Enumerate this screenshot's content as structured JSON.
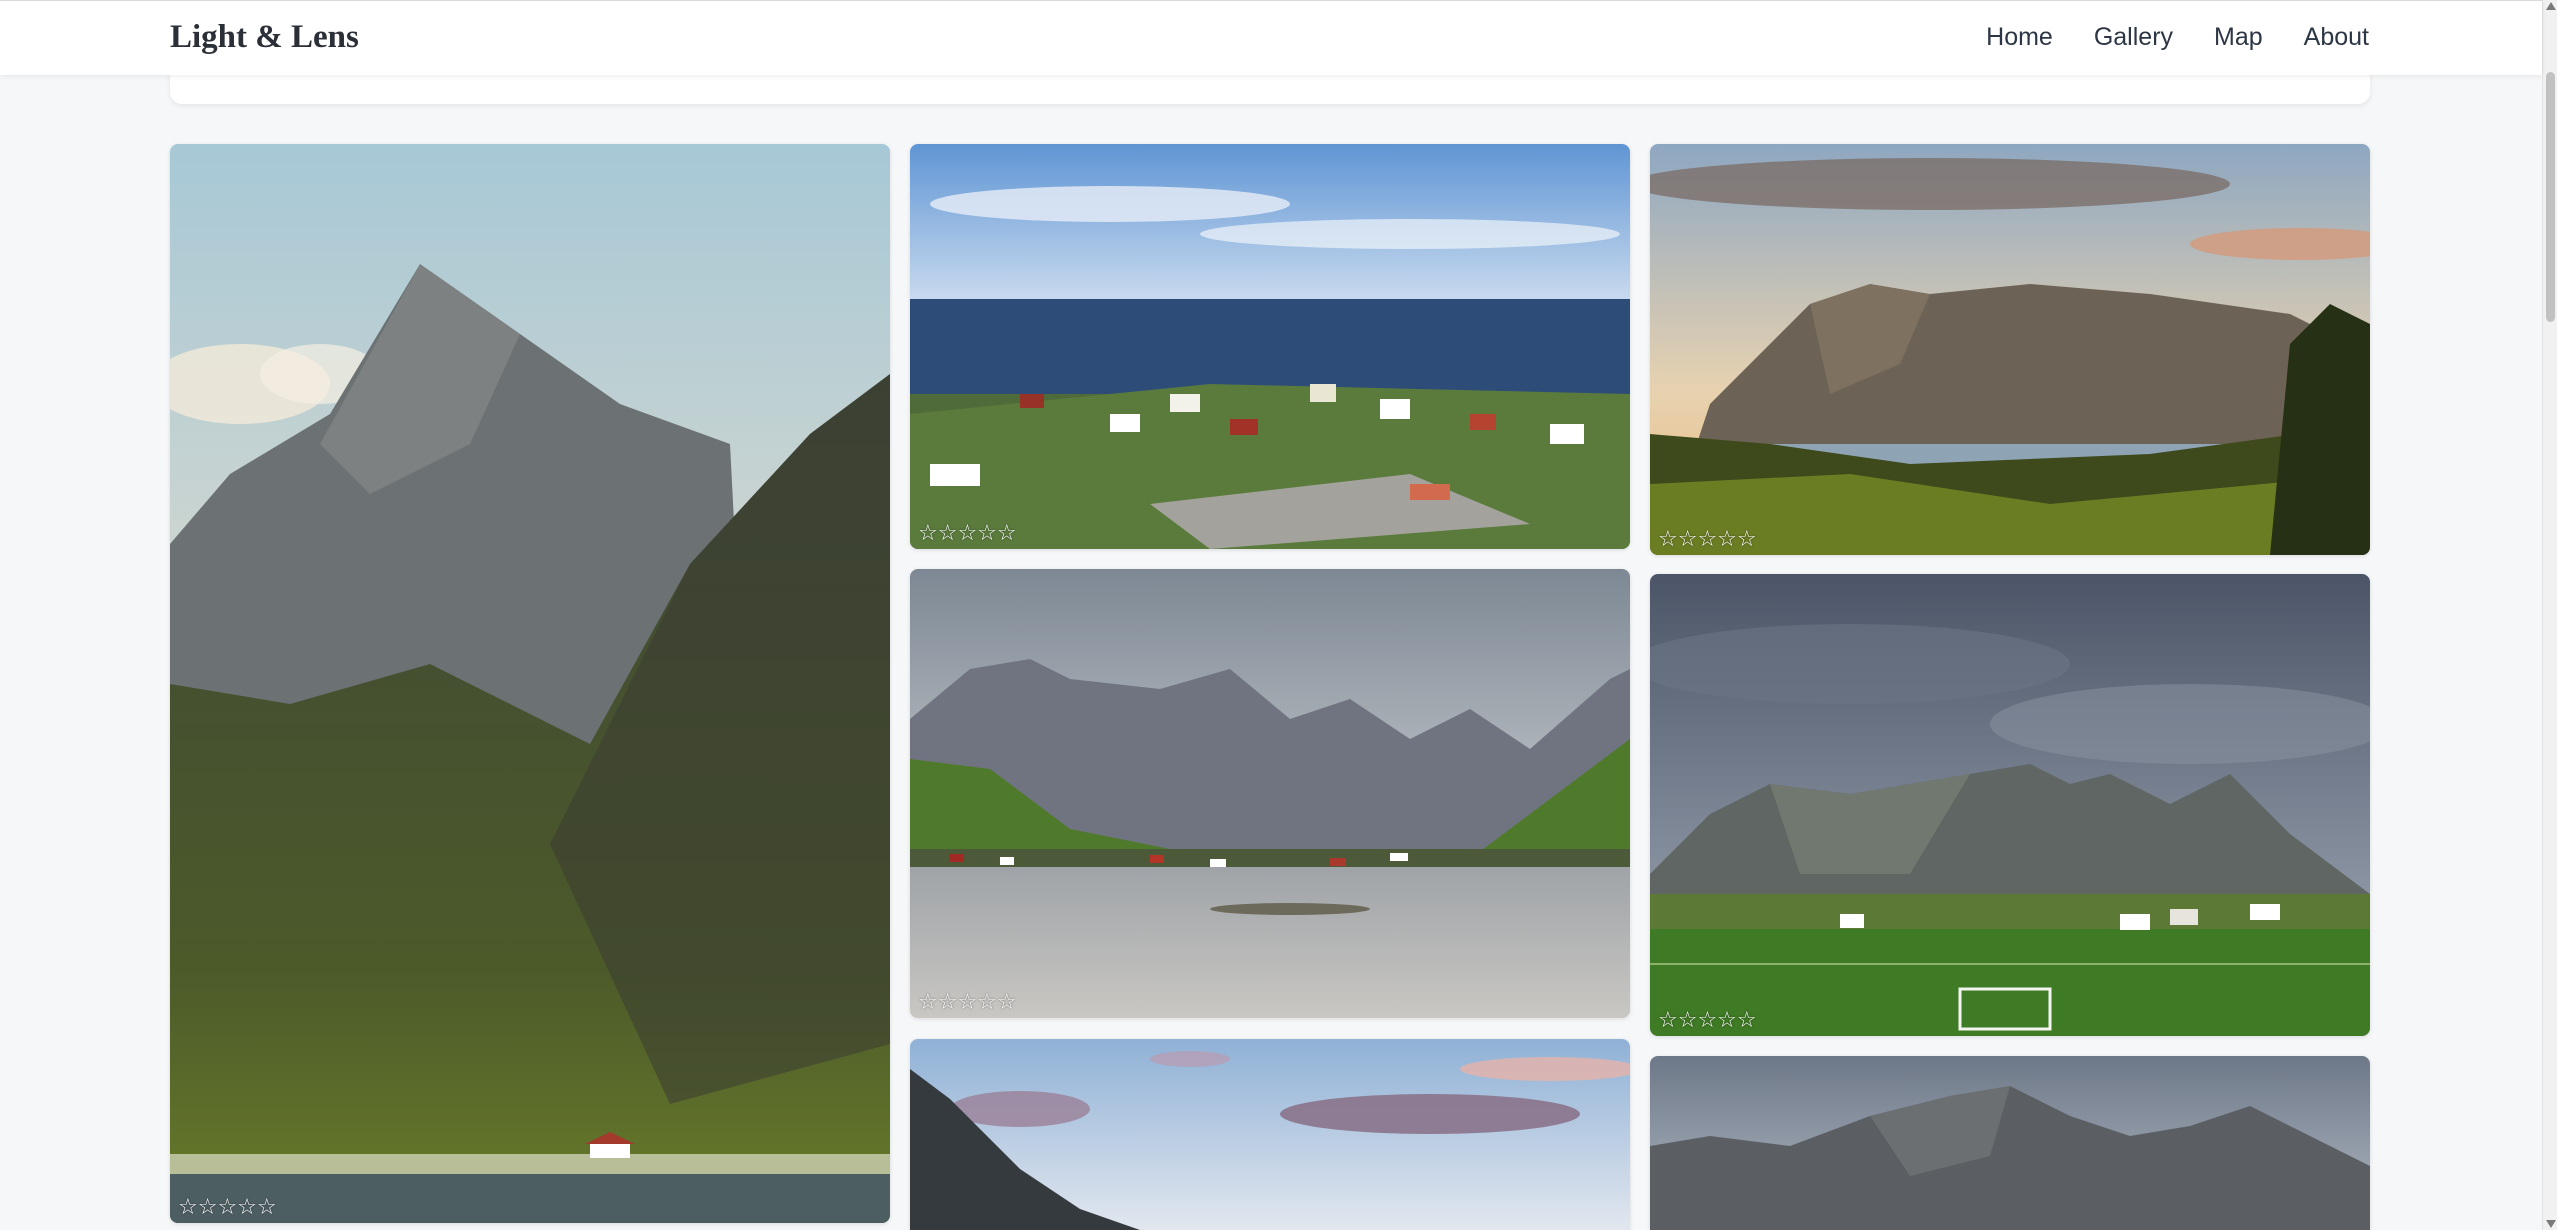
{
  "navbar": {
    "brand": "Light & Lens",
    "links": [
      "Home",
      "Gallery",
      "Map",
      "About"
    ]
  },
  "gallery": {
    "photos": [
      {
        "name": "mountain-peak",
        "rating": 0,
        "stars": "☆☆☆☆☆"
      },
      {
        "name": "coastal-village",
        "rating": 0,
        "stars": "☆☆☆☆☆"
      },
      {
        "name": "sunset-mountain",
        "rating": 0,
        "stars": "☆☆☆☆☆"
      },
      {
        "name": "fjord-village",
        "rating": 0,
        "stars": "☆☆☆☆☆"
      },
      {
        "name": "football-field",
        "rating": 0,
        "stars": "☆☆☆☆☆"
      },
      {
        "name": "pink-clouds",
        "rating": 0,
        "stars": "☆☆☆☆☆"
      },
      {
        "name": "rocky-peaks",
        "rating": 0,
        "stars": "☆☆☆☆☆"
      }
    ]
  },
  "colors": {
    "page_background": "#f5f7f9",
    "navbar_background": "#ffffff",
    "brand_text": "#2b2f38",
    "star": "#ffffff"
  },
  "icons": {
    "star": "empty-star-icon",
    "scroll_up": "scroll-up-arrow-icon",
    "scroll_down": "scroll-down-arrow-icon"
  }
}
